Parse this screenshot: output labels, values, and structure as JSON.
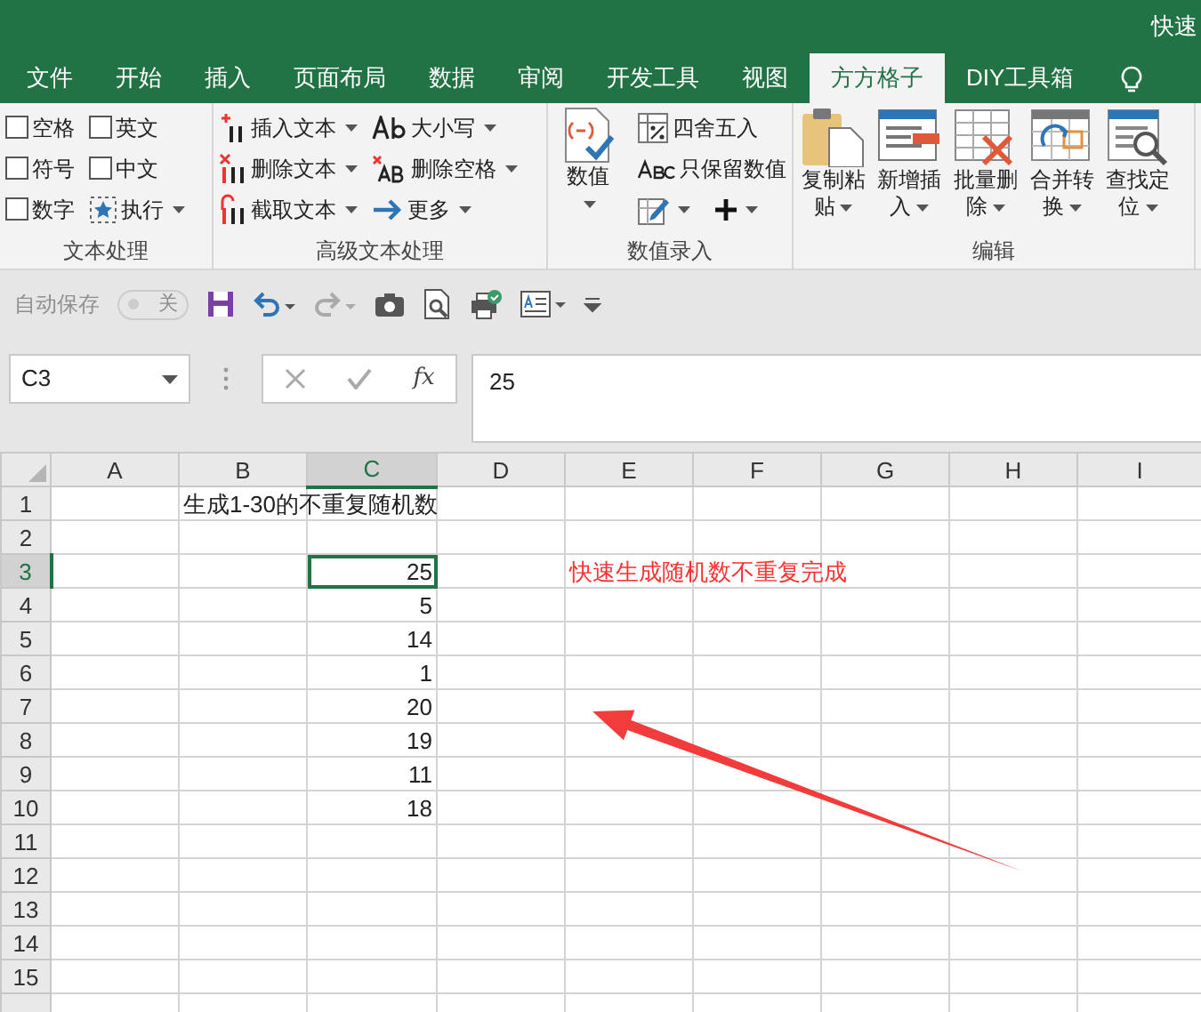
{
  "title_bar": {
    "title": "快速"
  },
  "tabs": [
    {
      "label": "文件",
      "selected": false
    },
    {
      "label": "开始",
      "selected": false
    },
    {
      "label": "插入",
      "selected": false
    },
    {
      "label": "页面布局",
      "selected": false
    },
    {
      "label": "数据",
      "selected": false
    },
    {
      "label": "审阅",
      "selected": false
    },
    {
      "label": "开发工具",
      "selected": false
    },
    {
      "label": "视图",
      "selected": false
    },
    {
      "label": "方方格子",
      "selected": true
    },
    {
      "label": "DIY工具箱",
      "selected": false
    }
  ],
  "ribbon": [
    {
      "label": "文本处理",
      "columns": [
        [
          {
            "kind": "checkbox",
            "label": "空格",
            "checked": false
          },
          {
            "kind": "checkbox",
            "label": "符号",
            "checked": false
          },
          {
            "kind": "checkbox",
            "label": "数字",
            "checked": false
          }
        ],
        [
          {
            "kind": "checkbox",
            "label": "英文",
            "checked": false
          },
          {
            "kind": "checkbox",
            "label": "中文",
            "checked": false
          },
          {
            "kind": "button",
            "label": "执行",
            "dropdown": true
          }
        ]
      ]
    },
    {
      "label": "高级文本处理",
      "columns": [
        [
          {
            "kind": "button",
            "label": "插入文本",
            "dropdown": true
          },
          {
            "kind": "button",
            "label": "删除文本",
            "dropdown": true
          },
          {
            "kind": "button",
            "label": "截取文本",
            "dropdown": true
          }
        ],
        [
          {
            "kind": "button",
            "label": "大小写",
            "dropdown": true
          },
          {
            "kind": "button",
            "label": "删除空格",
            "dropdown": true
          },
          {
            "kind": "button",
            "label": "更多",
            "dropdown": true
          }
        ]
      ]
    },
    {
      "label": "数值录入",
      "columns": [
        [
          {
            "kind": "large",
            "label": "数值",
            "dropdown": true
          }
        ],
        [
          {
            "kind": "button",
            "label": "四舍五入",
            "dropdown": false
          },
          {
            "kind": "button",
            "label": "只保留数值",
            "dropdown": false
          },
          {
            "kind": "pair",
            "dropdown": true
          }
        ]
      ]
    },
    {
      "label": "编辑",
      "columns": [
        [
          {
            "kind": "large",
            "label": "复制粘贴",
            "dropdown": true
          }
        ],
        [
          {
            "kind": "large",
            "label": "新增插入",
            "dropdown": true
          }
        ],
        [
          {
            "kind": "large",
            "label": "批量删除",
            "dropdown": true
          }
        ],
        [
          {
            "kind": "large",
            "label": "合并转换",
            "dropdown": true
          }
        ],
        [
          {
            "kind": "large",
            "label": "查找定位",
            "dropdown": true
          }
        ]
      ]
    }
  ],
  "quick_access": {
    "autosave_label": "自动保存",
    "autosave_toggle": {
      "label": "关",
      "on": false,
      "disabled": true
    }
  },
  "formula_bar": {
    "name_box": "C3",
    "function_label": "fx",
    "formula": "25"
  },
  "sheet": {
    "columns": [
      {
        "label": "A",
        "selected": false
      },
      {
        "label": "B",
        "selected": false
      },
      {
        "label": "C",
        "selected": true
      },
      {
        "label": "D",
        "selected": false
      },
      {
        "label": "E",
        "selected": false
      },
      {
        "label": "F",
        "selected": false
      },
      {
        "label": "G",
        "selected": false
      },
      {
        "label": "H",
        "selected": false
      },
      {
        "label": "I",
        "selected": false
      }
    ],
    "rows": [
      {
        "label": "1",
        "selected": false,
        "cells": [
          null,
          {
            "kind": "text",
            "value": "生成1-30的不重复随机数",
            "selected": false
          }
        ]
      },
      {
        "label": "2",
        "selected": false,
        "cells": []
      },
      {
        "label": "3",
        "selected": true,
        "cells": [
          null,
          null,
          {
            "kind": "number",
            "value": "25",
            "selected": true
          },
          null,
          {
            "kind": "note",
            "value": "快速生成随机数不重复完成",
            "selected": false
          }
        ]
      },
      {
        "label": "4",
        "selected": false,
        "cells": [
          null,
          null,
          {
            "kind": "number",
            "value": "5",
            "selected": false
          }
        ]
      },
      {
        "label": "5",
        "selected": false,
        "cells": [
          null,
          null,
          {
            "kind": "number",
            "value": "14",
            "selected": false
          }
        ]
      },
      {
        "label": "6",
        "selected": false,
        "cells": [
          null,
          null,
          {
            "kind": "number",
            "value": "1",
            "selected": false
          }
        ]
      },
      {
        "label": "7",
        "selected": false,
        "cells": [
          null,
          null,
          {
            "kind": "number",
            "value": "20",
            "selected": false
          }
        ]
      },
      {
        "label": "8",
        "selected": false,
        "cells": [
          null,
          null,
          {
            "kind": "number",
            "value": "19",
            "selected": false
          }
        ]
      },
      {
        "label": "9",
        "selected": false,
        "cells": [
          null,
          null,
          {
            "kind": "number",
            "value": "11",
            "selected": false
          }
        ]
      },
      {
        "label": "10",
        "selected": false,
        "cells": [
          null,
          null,
          {
            "kind": "number",
            "value": "18",
            "selected": false
          }
        ]
      },
      {
        "label": "11",
        "selected": false,
        "cells": []
      },
      {
        "label": "12",
        "selected": false,
        "cells": []
      },
      {
        "label": "13",
        "selected": false,
        "cells": []
      },
      {
        "label": "14",
        "selected": false,
        "cells": []
      },
      {
        "label": "15",
        "selected": false,
        "cells": []
      }
    ]
  }
}
